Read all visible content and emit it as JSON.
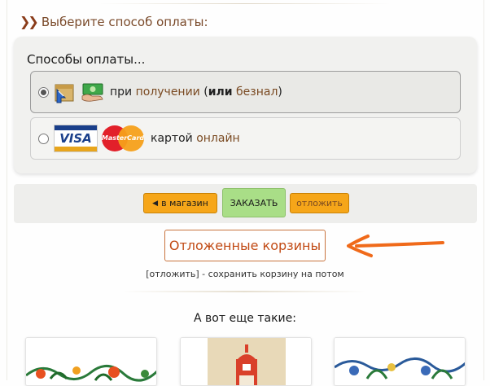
{
  "payment": {
    "section_title": "Выберите способ оплаты:",
    "methods_title": "Способы оплаты...",
    "options": [
      {
        "selected": true,
        "icons": [
          "delivery-box-icon",
          "cash-icon"
        ],
        "text_pre": "при ",
        "text_link1": "получении",
        "text_open": " (",
        "text_bold": "или",
        "text_space": " ",
        "text_link2": "безнал",
        "text_close": ")"
      },
      {
        "selected": false,
        "icons": [
          "visa-icon",
          "mastercard-icon"
        ],
        "visa_label": "VISA",
        "mastercard_label": "MasterCard",
        "text_pre": "картой ",
        "text_link": "онлайн"
      }
    ]
  },
  "actions": {
    "to_shop_label": "в магазин",
    "order_label": "ЗАКАЗАТЬ",
    "defer_label": "отложить"
  },
  "saved_baskets": {
    "button_label": "Отложенные корзины",
    "hint": "[отложить] - сохранить корзину на потом"
  },
  "recommendations": {
    "title": "А вот еще такие:"
  },
  "colors": {
    "accent_orange": "#f6a619",
    "order_green": "#a9de87",
    "link_brown": "#7a4a22",
    "saved_red": "#c14a14",
    "annotation_arrow": "#f06a1a"
  }
}
